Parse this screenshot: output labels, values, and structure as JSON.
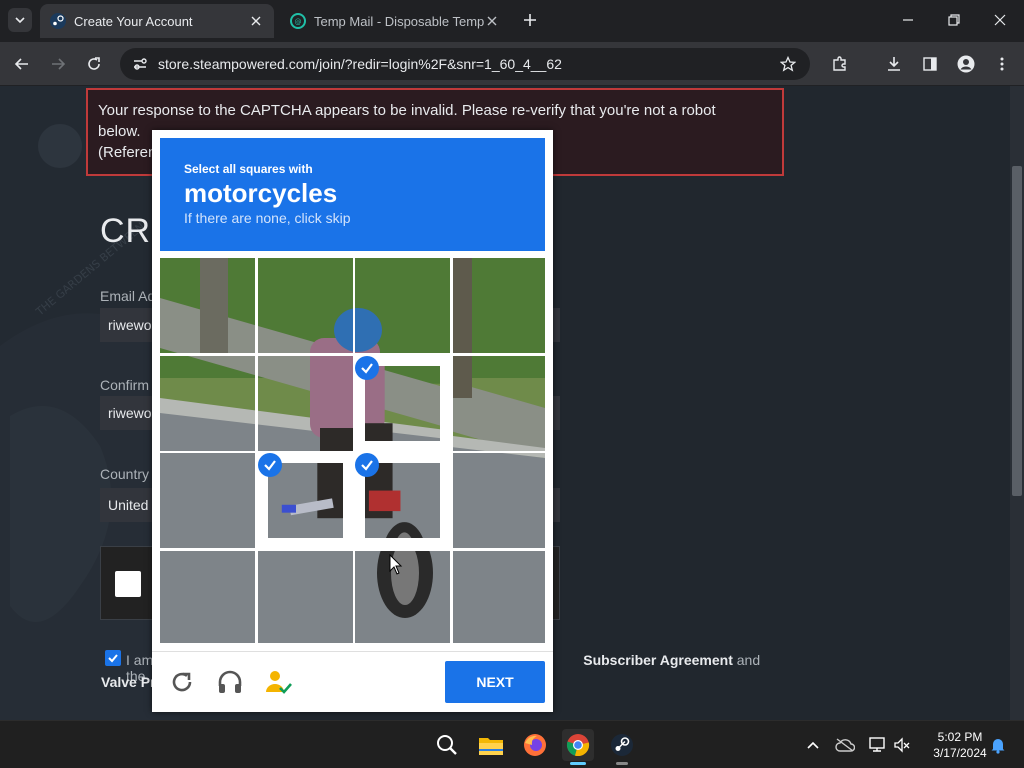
{
  "browser": {
    "tabs": [
      {
        "title": "Create Your Account",
        "active": true
      },
      {
        "title": "Temp Mail - Disposable Tempo",
        "active": false
      }
    ],
    "url": "store.steampowered.com/join/?redir=login%2F&snr=1_60_4__62"
  },
  "page": {
    "error_line1": "Your response to the CAPTCHA appears to be invalid. Please re-verify that you're not a robot",
    "error_line2": "below.",
    "error_line3": "(Referen",
    "heading": "CRI",
    "email_label": "Email Ad",
    "email_value": "riwewo",
    "confirm_label": "Confirm",
    "confirm_value": "riwewo",
    "country_label": "Country",
    "country_value": "United",
    "agree_prefix": "I am",
    "agree_link": "Subscriber Agreement",
    "agree_suffix": " and the",
    "privacy_partial": "Valve Pr"
  },
  "captcha": {
    "instruction": "Select all squares with",
    "target": "motorcycles",
    "hint": "If there are none, click skip",
    "selected_cells": [
      6,
      9,
      10
    ],
    "next_label": "NEXT",
    "footer_icons": [
      "reload-icon",
      "audio-icon",
      "info-icon"
    ]
  },
  "taskbar": {
    "time": "5:02 PM",
    "date": "3/17/2024",
    "apps": [
      "search-icon",
      "file-explorer-icon",
      "firefox-icon",
      "chrome-icon",
      "steam-icon"
    ],
    "active_app": "chrome-icon"
  },
  "colors": {
    "captcha_blue": "#1a73e8",
    "error_border": "#c03a3a",
    "steam_bg": "#21272e"
  }
}
